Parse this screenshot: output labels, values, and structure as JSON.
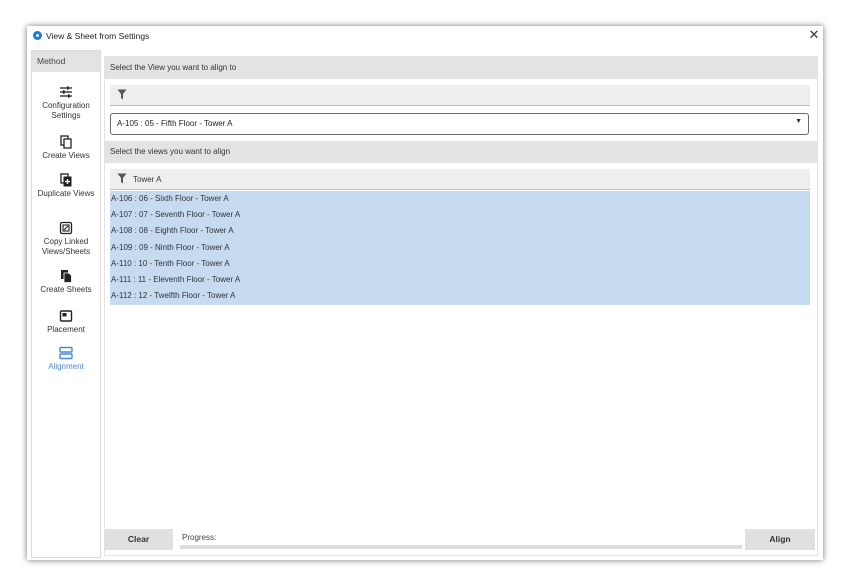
{
  "window": {
    "title": "View & Sheet from Settings",
    "close_glyph": "✕"
  },
  "sidebar": {
    "header": "Method",
    "items": [
      {
        "label": "Configuration Settings",
        "icon": "sliders-icon",
        "active": false
      },
      {
        "label": "Create Views",
        "icon": "copy-icon",
        "active": false
      },
      {
        "label": "Duplicate Views",
        "icon": "duplicate-icon",
        "active": false
      },
      {
        "label": "Copy Linked Views/Sheets",
        "icon": "link-copy-icon",
        "active": false
      },
      {
        "label": "Create Sheets",
        "icon": "sheets-icon",
        "active": false
      },
      {
        "label": "Placement",
        "icon": "placement-icon",
        "active": false
      },
      {
        "label": "Alignment",
        "icon": "alignment-icon",
        "active": true
      }
    ],
    "active_color": "#4a89d8"
  },
  "target": {
    "header": "Select the View you want to align to",
    "filter_value": "",
    "selected_view": "A-105 : 05 - Fifth Floor - Tower A"
  },
  "views": {
    "header": "Select the views you want to align",
    "filter_value": "Tower A",
    "items": [
      "A-106 : 06 - Sixth Floor - Tower A",
      "A-107 : 07 - Seventh Floor - Tower A",
      "A-108 : 08 - Eighth Floor - Tower A",
      "A-109 : 09 - Ninth Floor - Tower A",
      "A-110 : 10 - Tenth Floor - Tower A",
      "A-111 : 11 - Eleventh Floor - Tower A",
      "A-112 : 12 - Twelfth Floor - Tower A"
    ],
    "selection_color": "#c6daf0"
  },
  "footer": {
    "clear_label": "Clear",
    "progress_label": "Progress:",
    "progress_value": 0,
    "align_label": "Align"
  }
}
